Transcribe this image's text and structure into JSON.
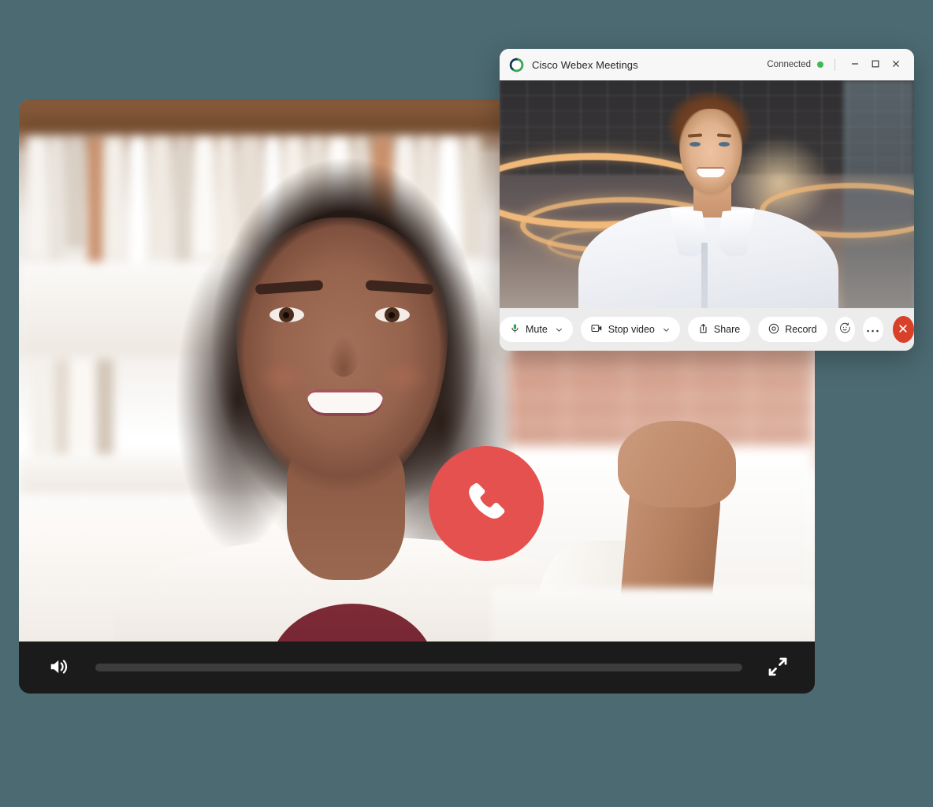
{
  "theme": {
    "page_background": "#4c6a72",
    "call_button_color": "#e5514f",
    "end_call_color": "#d9402a",
    "status_dot_color": "#3fb950",
    "mic_icon_color": "#2fa84f",
    "player_bar_color": "#1b1b1b"
  },
  "webex_window": {
    "title": "Cisco Webex Meetings",
    "logo_icon": "webex-logo-icon",
    "status": {
      "label": "Connected",
      "dot_icon": "status-dot-icon"
    },
    "window_controls": [
      {
        "name": "minimize",
        "icon": "minimize-icon"
      },
      {
        "name": "maximize",
        "icon": "maximize-icon"
      },
      {
        "name": "close",
        "icon": "close-icon"
      }
    ],
    "video": {
      "participant_description": "Smiling man in white shirt in a modern office with ring lights"
    },
    "toolbar": {
      "mute_label": "Mute",
      "mute_icon": "microphone-icon",
      "mute_caret_icon": "chevron-down-icon",
      "stop_video_label": "Stop video",
      "stop_video_icon": "video-camera-icon",
      "stop_video_caret_icon": "chevron-down-icon",
      "share_label": "Share",
      "share_icon": "share-upload-icon",
      "record_label": "Record",
      "record_icon": "record-circle-icon",
      "reactions_icon": "smiley-reaction-icon",
      "more_icon": "more-ellipsis-icon",
      "end_call_icon": "close-x-icon"
    }
  },
  "video_player": {
    "subject_description": "Smiling woman with long dark wavy hair in a white blazer waving in front of a bookshelf",
    "call_button_icon": "phone-handset-icon",
    "controls": {
      "volume_icon": "speaker-volume-icon",
      "progress_value": 0,
      "fullscreen_icon": "fullscreen-expand-icon"
    }
  }
}
